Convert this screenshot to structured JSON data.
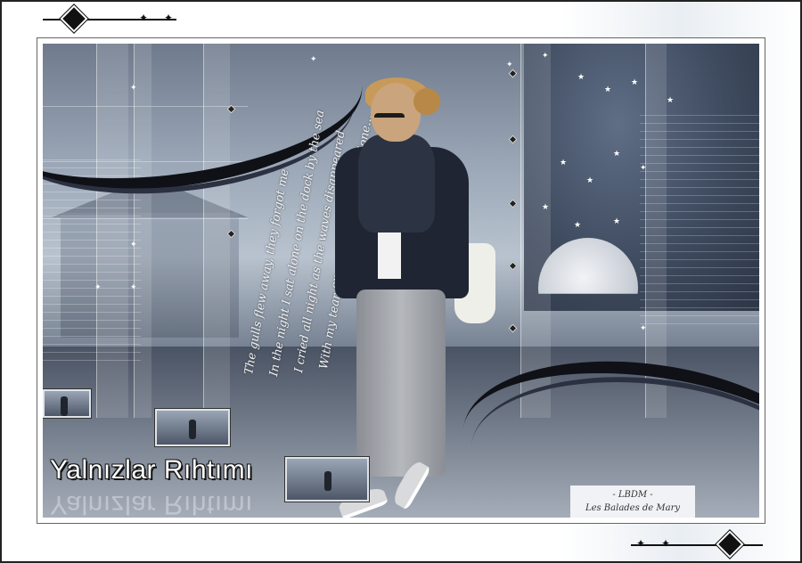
{
  "artwork": {
    "title": "Yalnızlar Rıhtımı",
    "poem_lines": [
      "The gulls flew away, they forgot me",
      "In the night I sat alone on the dock by the sea",
      "I cried all night as the waves disappeared",
      "With my tear filled eyes on the dock alone..."
    ],
    "signature_line1": "- LBDM -",
    "signature_line2": "Les Balades de Mary"
  },
  "icons": {
    "corner_ornament": "diamond-icon",
    "sparkle": "sparkle-icon",
    "star": "star-icon"
  },
  "colors": {
    "frame": "#222222",
    "sky": "#3e4a5e",
    "title_text": "#ffffff"
  }
}
